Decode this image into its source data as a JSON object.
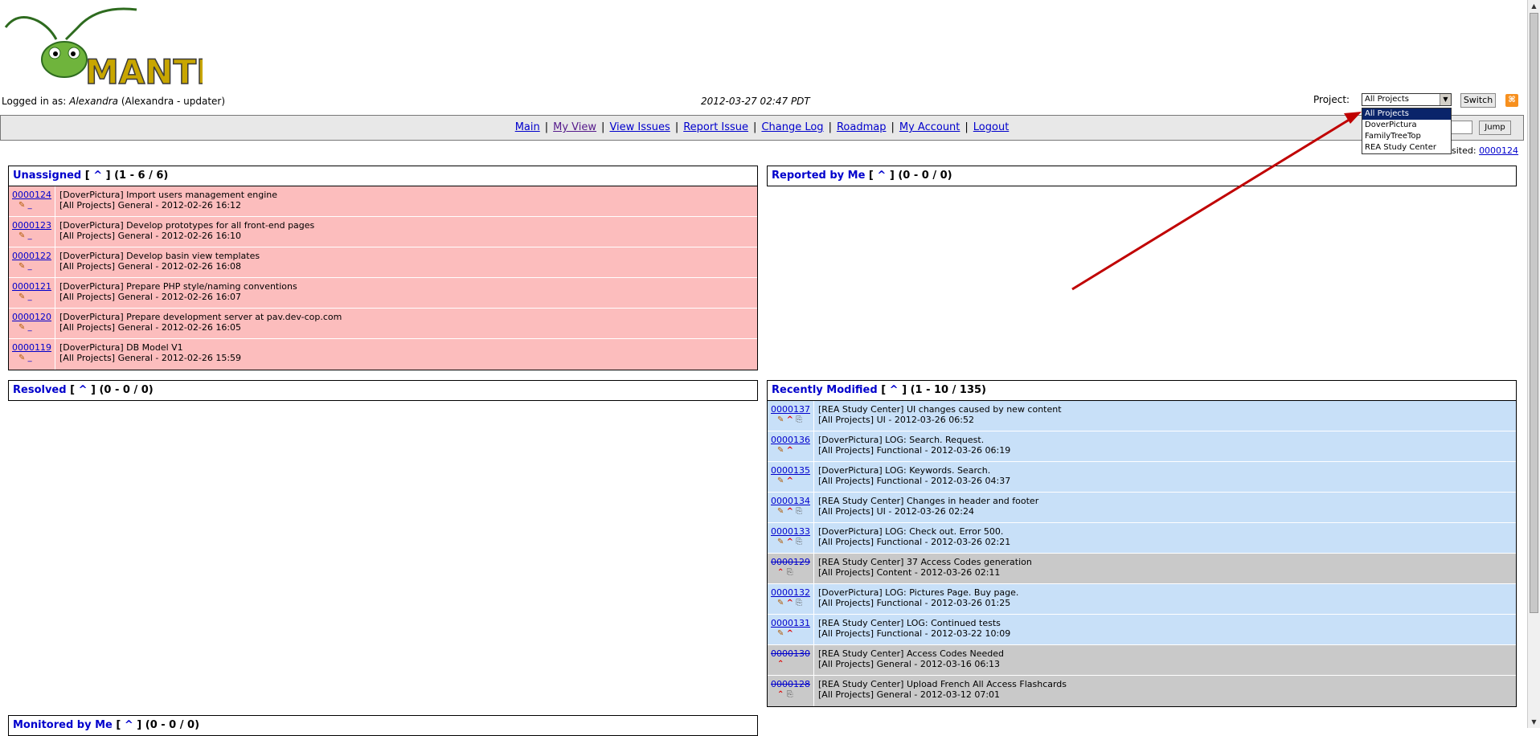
{
  "header": {
    "logo_text": "MANTIS",
    "logged_in_prefix": "Logged in as:",
    "user_name": "Alexandra",
    "user_role": "(Alexandra - updater)",
    "datetime": "2012-03-27 02:47 PDT",
    "project_label": "Project:",
    "project_selected": "All Projects",
    "switch_label": "Switch",
    "rss_icon": "rss-feed-icon"
  },
  "project_options": [
    "All Projects",
    "DoverPictura",
    "FamilyTreeTop",
    "REA Study Center"
  ],
  "menu": [
    {
      "label": "Main"
    },
    {
      "label": "My View"
    },
    {
      "label": "View Issues"
    },
    {
      "label": "Report Issue"
    },
    {
      "label": "Change Log"
    },
    {
      "label": "Roadmap"
    },
    {
      "label": "My Account"
    },
    {
      "label": "Logout"
    }
  ],
  "jump": {
    "label": "Jump",
    "value": ""
  },
  "recently_visited": {
    "label": "sited:",
    "id": "0000124"
  },
  "panels": {
    "unassigned": {
      "title": "Unassigned",
      "caret": "^",
      "count": "(1 - 6 / 6)",
      "rows": [
        {
          "id": "0000124",
          "summary": "[DoverPictura] Import users management engine",
          "meta": "[All Projects] General - 2012-02-26 16:12"
        },
        {
          "id": "0000123",
          "summary": "[DoverPictura] Develop prototypes for all front-end pages",
          "meta": "[All Projects] General - 2012-02-26 16:10"
        },
        {
          "id": "0000122",
          "summary": "[DoverPictura] Develop basin view templates",
          "meta": "[All Projects] General - 2012-02-26 16:08"
        },
        {
          "id": "0000121",
          "summary": "[DoverPictura] Prepare PHP style/naming conventions",
          "meta": "[All Projects] General - 2012-02-26 16:07"
        },
        {
          "id": "0000120",
          "summary": "[DoverPictura] Prepare development server at pav.dev-cop.com",
          "meta": "[All Projects] General - 2012-02-26 16:05"
        },
        {
          "id": "0000119",
          "summary": "[DoverPictura] DB Model V1",
          "meta": "[All Projects] General - 2012-02-26 15:59"
        }
      ]
    },
    "reported": {
      "title": "Reported by Me",
      "caret": "^",
      "count": "(0 - 0 / 0)"
    },
    "resolved": {
      "title": "Resolved",
      "caret": "^",
      "count": "(0 - 0 / 0)"
    },
    "monitored": {
      "title": "Monitored by Me",
      "caret": "^",
      "count": "(0 - 0 / 0)"
    },
    "recent": {
      "title": "Recently Modified",
      "caret": "^",
      "count": "(1 - 10 / 135)",
      "rows": [
        {
          "id": "0000137",
          "summary": "[REA Study Center] UI changes caused by new content",
          "meta": "[All Projects] UI - 2012-03-26 06:52",
          "status": "open",
          "icons": "edit,up,clip"
        },
        {
          "id": "0000136",
          "summary": "[DoverPictura] LOG: Search. Request.",
          "meta": "[All Projects] Functional - 2012-03-26 06:19",
          "status": "open",
          "icons": "edit,up"
        },
        {
          "id": "0000135",
          "summary": "[DoverPictura] LOG: Keywords. Search.",
          "meta": "[All Projects] Functional - 2012-03-26 04:37",
          "status": "open",
          "icons": "edit,up"
        },
        {
          "id": "0000134",
          "summary": "[REA Study Center] Changes in header and footer",
          "meta": "[All Projects] UI - 2012-03-26 02:24",
          "status": "open",
          "icons": "edit,up,clip"
        },
        {
          "id": "0000133",
          "summary": "[DoverPictura] LOG: Check out. Error 500.",
          "meta": "[All Projects] Functional - 2012-03-26 02:21",
          "status": "open",
          "icons": "edit,up,clip"
        },
        {
          "id": "0000129",
          "summary": "[REA Study Center] 37 Access Codes generation",
          "meta": "[All Projects] Content - 2012-03-26 02:11",
          "status": "closed",
          "icons": "up2,clip"
        },
        {
          "id": "0000132",
          "summary": "[DoverPictura] LOG: Pictures Page. Buy page.",
          "meta": "[All Projects] Functional - 2012-03-26 01:25",
          "status": "open",
          "icons": "edit,up,clip"
        },
        {
          "id": "0000131",
          "summary": "[REA Study Center] LOG: Continued tests",
          "meta": "[All Projects] Functional - 2012-03-22 10:09",
          "status": "open",
          "icons": "edit,up"
        },
        {
          "id": "0000130",
          "summary": "[REA Study Center] Access Codes Needed",
          "meta": "[All Projects] General - 2012-03-16 06:13",
          "status": "closed",
          "icons": "up2"
        },
        {
          "id": "0000128",
          "summary": "[REA Study Center] Upload French All Access Flashcards",
          "meta": "[All Projects] General - 2012-03-12 07:01",
          "status": "closed",
          "icons": "up2,clip"
        }
      ]
    }
  }
}
